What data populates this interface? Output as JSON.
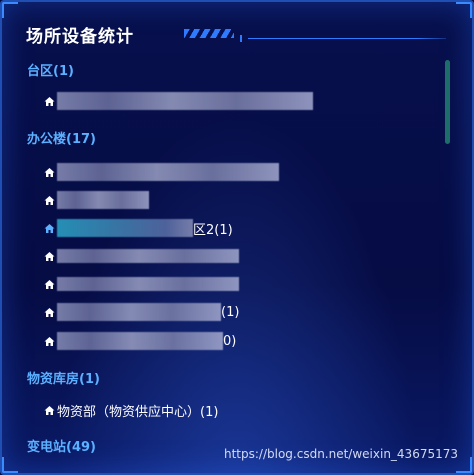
{
  "panel": {
    "title": "场所设备统计"
  },
  "groups": [
    {
      "label": "台区(1)"
    },
    {
      "label": "办公楼(17)"
    },
    {
      "label": "物资库房(1)"
    },
    {
      "label": "变电站(49)"
    }
  ],
  "office_items": [
    {
      "suffix": ""
    },
    {
      "suffix": ""
    },
    {
      "suffix": "区2(1)"
    },
    {
      "suffix": ""
    },
    {
      "suffix": ""
    },
    {
      "suffix": "(1)"
    },
    {
      "suffix": "0)"
    }
  ],
  "warehouse_items": [
    {
      "label": "物资部（物资供应中心）(1)"
    }
  ],
  "watermark": "https://blog.csdn.net/weixin_43675173",
  "colors": {
    "accent": "#2f7bff",
    "group_text": "#5bb0ff",
    "background": "#050a3a"
  },
  "icons": {
    "tree_item": "home-icon"
  }
}
